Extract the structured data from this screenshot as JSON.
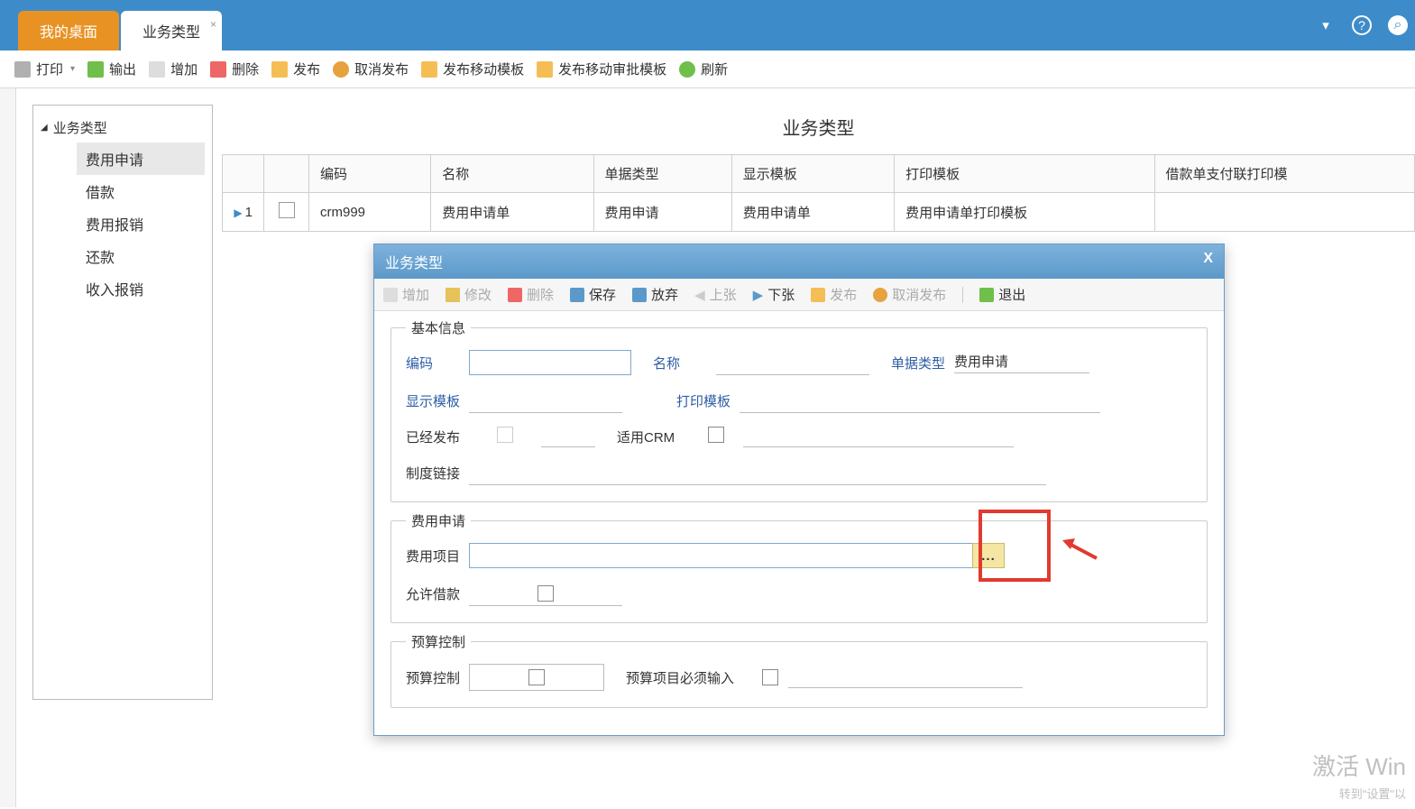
{
  "topbar": {
    "tabs": [
      {
        "label": "我的桌面"
      },
      {
        "label": "业务类型"
      }
    ],
    "icons": {
      "dropdown": "▾",
      "help": "?",
      "search": "⌕"
    }
  },
  "toolbar": {
    "print": "打印",
    "export": "输出",
    "add": "增加",
    "delete": "删除",
    "publish": "发布",
    "unpublish": "取消发布",
    "publish_mobile_tpl": "发布移动模板",
    "publish_mobile_approve_tpl": "发布移动审批模板",
    "refresh": "刷新"
  },
  "page_title": "业务类型",
  "tree": {
    "root": "业务类型",
    "items": [
      "费用申请",
      "借款",
      "费用报销",
      "还款",
      "收入报销"
    ],
    "selected": 0
  },
  "grid": {
    "columns": [
      "编码",
      "名称",
      "单据类型",
      "显示模板",
      "打印模板",
      "借款单支付联打印模"
    ],
    "rows": [
      {
        "num": "1",
        "code": "crm999",
        "name": "费用申请单",
        "bill_type": "费用申请",
        "display_tpl": "费用申请单",
        "print_tpl": "费用申请单打印模板"
      }
    ]
  },
  "dialog": {
    "title": "业务类型",
    "toolbar": {
      "add": "增加",
      "edit": "修改",
      "delete": "删除",
      "save": "保存",
      "discard": "放弃",
      "prev": "上张",
      "next": "下张",
      "publish": "发布",
      "unpublish": "取消发布",
      "exit": "退出"
    },
    "sections": {
      "basic": {
        "legend": "基本信息",
        "code_label": "编码",
        "code_value": "",
        "name_label": "名称",
        "name_value": "",
        "bill_type_label": "单据类型",
        "bill_type_value": "费用申请",
        "display_tpl_label": "显示模板",
        "display_tpl_value": "",
        "print_tpl_label": "打印模板",
        "print_tpl_value": "",
        "published_label": "已经发布",
        "crm_label": "适用CRM",
        "link_label": "制度链接",
        "link_value": ""
      },
      "expense": {
        "legend": "费用申请",
        "item_label": "费用项目",
        "item_value": "",
        "lookup_btn": "...",
        "allow_loan_label": "允许借款"
      },
      "budget": {
        "legend": "预算控制",
        "budget_ctrl_label": "预算控制",
        "budget_item_required_label": "预算项目必须输入"
      }
    }
  },
  "watermark": {
    "line1": "激活 Win",
    "line2": "转到\"设置\"以"
  }
}
